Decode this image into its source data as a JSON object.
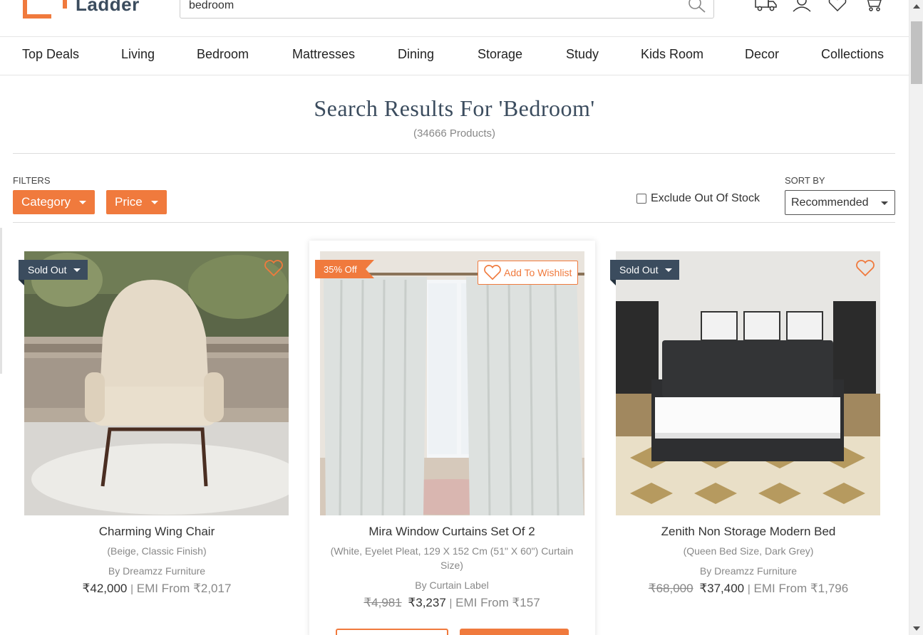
{
  "brand": {
    "name": "Ladder"
  },
  "search": {
    "value": "bedroom",
    "placeholder": ""
  },
  "header_icons": [
    "truck-icon",
    "user-icon",
    "heart-icon",
    "cart-icon"
  ],
  "nav": {
    "items": [
      {
        "label": "Top Deals"
      },
      {
        "label": "Living"
      },
      {
        "label": "Bedroom"
      },
      {
        "label": "Mattresses"
      },
      {
        "label": "Dining"
      },
      {
        "label": "Storage"
      },
      {
        "label": "Study"
      },
      {
        "label": "Kids Room"
      },
      {
        "label": "Decor"
      },
      {
        "label": "Collections"
      }
    ]
  },
  "results": {
    "title": "Search Results For 'Bedroom'",
    "count": "(34666 Products)"
  },
  "filters": {
    "label": "FILTERS",
    "category": "Category",
    "price": "Price",
    "exclude_label": "Exclude Out Of Stock",
    "exclude_checked": false
  },
  "sort": {
    "label": "SORT BY",
    "selected": "Recommended"
  },
  "products": [
    {
      "name": "Charming Wing Chair",
      "desc": "(Beige, Classic Finish)",
      "brand": "By Dreamzz Furniture",
      "old_price": "",
      "price": "₹42,000",
      "emi": "EMI From ₹2,017",
      "badge": "Sold Out"
    },
    {
      "name": "Mira Window Curtains Set Of 2",
      "desc": "(White, Eyelet Pleat, 129 X 152 Cm (51\" X 60\") Curtain Size)",
      "brand": "By Curtain Label",
      "old_price": "₹4,981",
      "price": "₹3,237",
      "emi": "EMI From ₹157",
      "badge": "35% Off",
      "wishlist_label": "Add To Wishlist"
    },
    {
      "name": "Zenith Non Storage Modern Bed",
      "desc": "(Queen Bed Size, Dark Grey)",
      "brand": "By Dreamzz Furniture",
      "old_price": "₹68,000",
      "price": "₹37,400",
      "emi": "EMI From ₹1,796",
      "badge": "Sold Out"
    }
  ],
  "colors": {
    "accent": "#f07a3d",
    "navy": "#3b4c5e"
  }
}
